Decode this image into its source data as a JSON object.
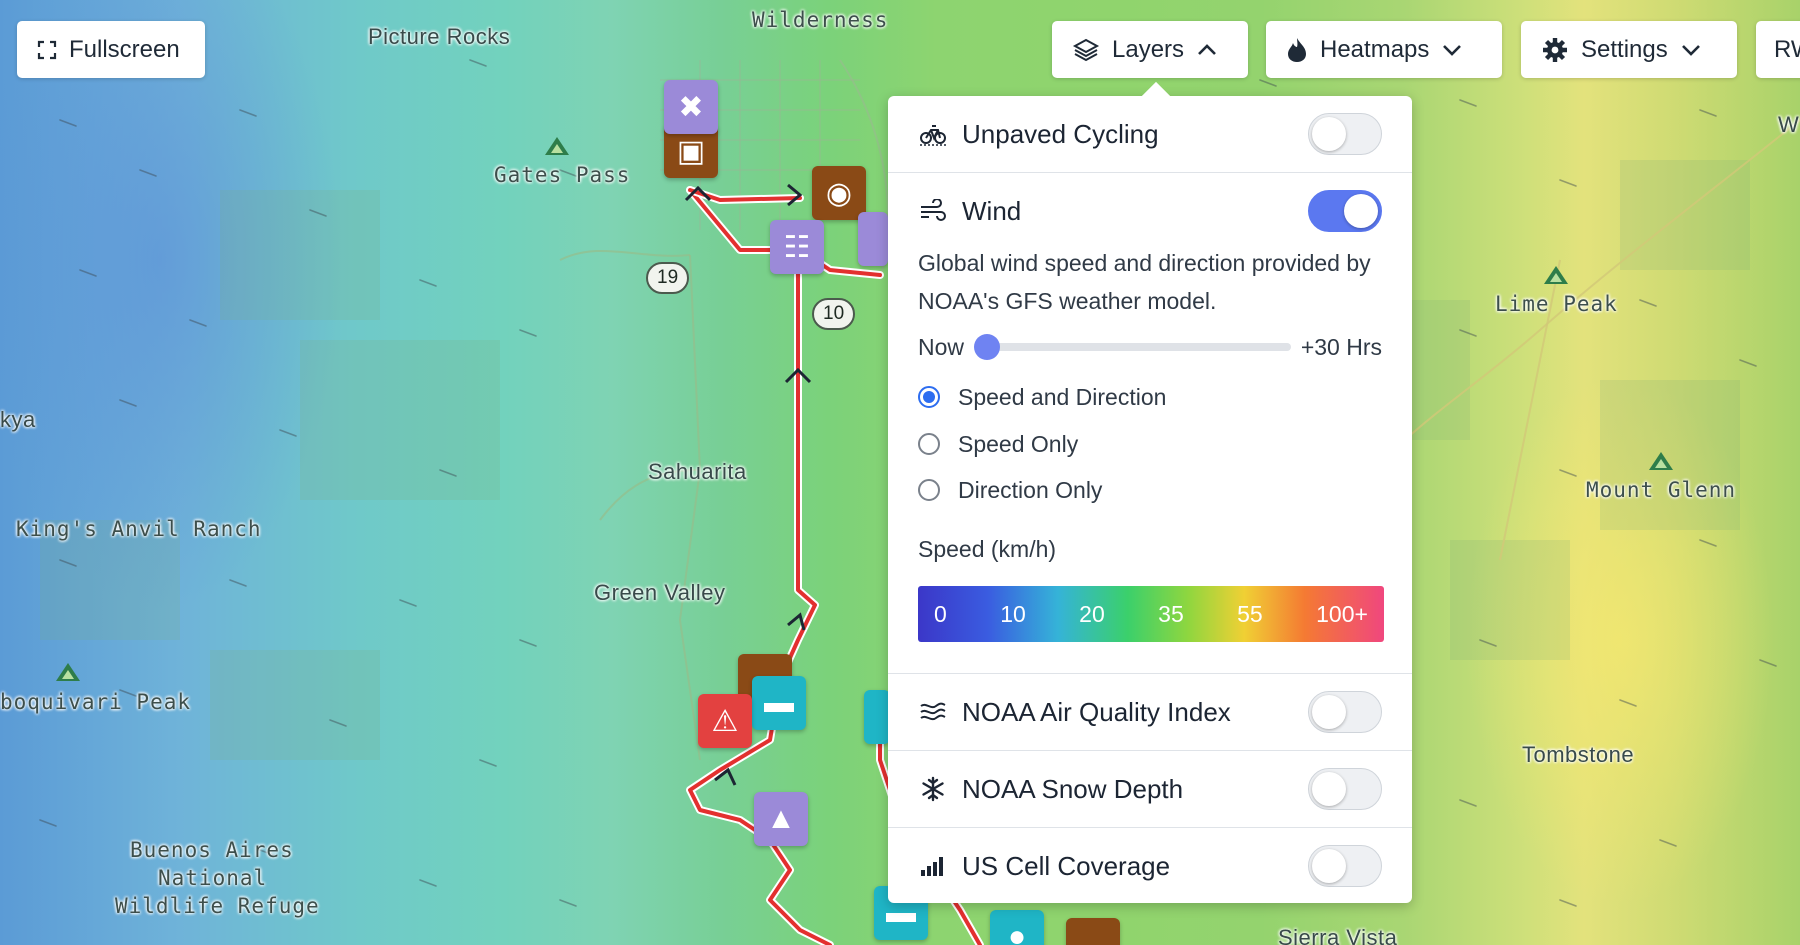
{
  "toolbar": {
    "fullscreen_label": "Fullscreen",
    "layers_label": "Layers",
    "heatmaps_label": "Heatmaps",
    "settings_label": "Settings",
    "rw_label": "RW"
  },
  "map": {
    "labels": {
      "picture_rocks": "Picture Rocks",
      "wilderness": "Wilderness",
      "gates_pass": "Gates Pass",
      "sahuarita": "Sahuarita",
      "kings_anvil": "King's Anvil Ranch",
      "green_valley": "Green Valley",
      "kya": "kya",
      "boquivari": "boquivari Peak",
      "buenos_aires_1": "Buenos Aires",
      "buenos_aires_2": "National",
      "buenos_aires_3": "Wildlife Refuge",
      "lime_peak": "Lime Peak",
      "mount_glenn": "Mount Glenn",
      "tombstone": "Tombstone",
      "sierra_vista": "Sierra Vista",
      "w_edge": "W"
    },
    "shields": {
      "route19": "19",
      "route10": "10"
    }
  },
  "layers_panel": {
    "unpaved_cycling": {
      "label": "Unpaved Cycling",
      "enabled": false
    },
    "wind": {
      "label": "Wind",
      "enabled": true,
      "description": "Global wind speed and direction provided by NOAA's GFS weather model.",
      "slider_start": "Now",
      "slider_end": "+30 Hrs",
      "slider_position": 0,
      "options": [
        "Speed and Direction",
        "Speed Only",
        "Direction Only"
      ],
      "selected_option": "Speed and Direction",
      "speed_title": "Speed (km/h)",
      "scale_values": [
        "0",
        "10",
        "20",
        "35",
        "55",
        "100+"
      ]
    },
    "air_quality": {
      "label": "NOAA Air Quality Index",
      "enabled": false
    },
    "snow_depth": {
      "label": "NOAA Snow Depth",
      "enabled": false
    },
    "cell_coverage": {
      "label": "US Cell Coverage",
      "enabled": false
    }
  },
  "colors": {
    "accent": "#5b78f0",
    "radio": "#2d6df0",
    "route": "#e3302f"
  }
}
